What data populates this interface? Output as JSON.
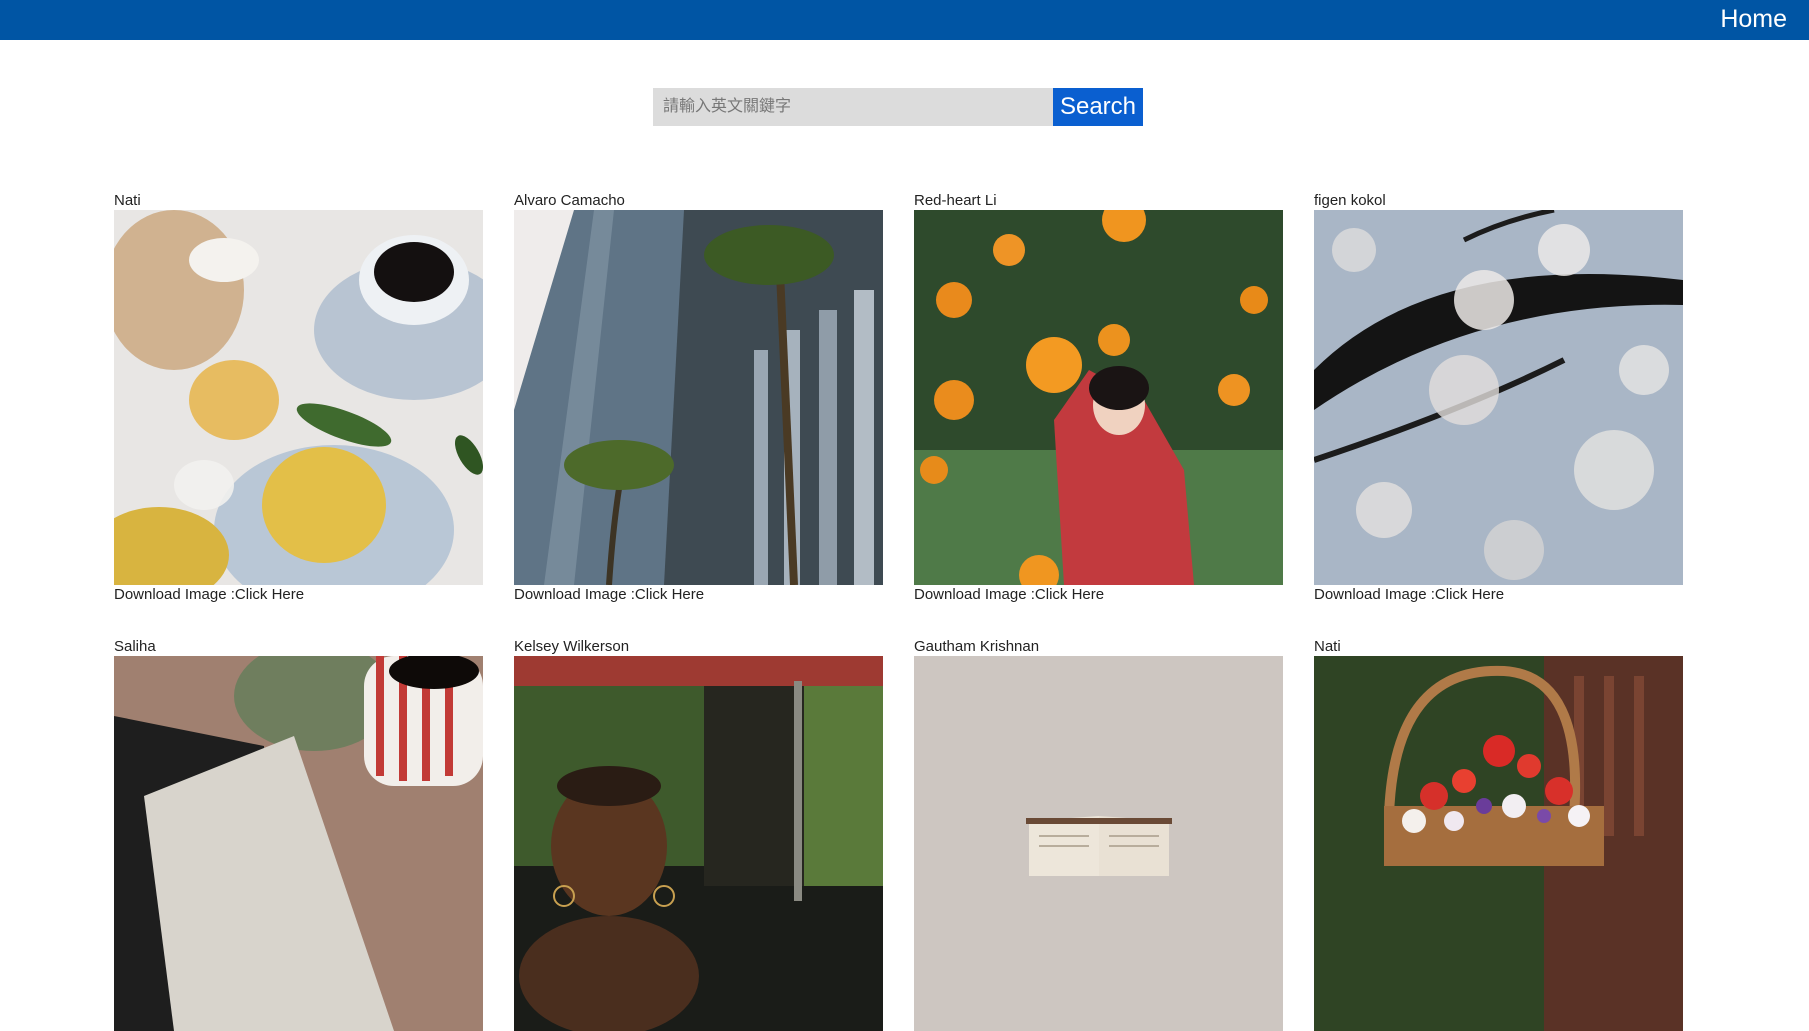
{
  "nav": {
    "home_label": "Home"
  },
  "search": {
    "placeholder": "請輸入英文關鍵字",
    "value": "",
    "button_label": "Search"
  },
  "gallery": {
    "download_prefix": "Download Image :",
    "download_link": "Click Here",
    "cards": [
      {
        "author": "Nati"
      },
      {
        "author": "Alvaro Camacho"
      },
      {
        "author": "Red-heart Li"
      },
      {
        "author": "figen kokol"
      },
      {
        "author": "Saliha"
      },
      {
        "author": "Kelsey Wilkerson"
      },
      {
        "author": "Gautham Krishnan"
      },
      {
        "author": "Nati"
      }
    ]
  },
  "colors": {
    "topbar": "#0055a4",
    "search_button": "#0a5fd0",
    "search_input_bg": "#dcdcdc"
  }
}
